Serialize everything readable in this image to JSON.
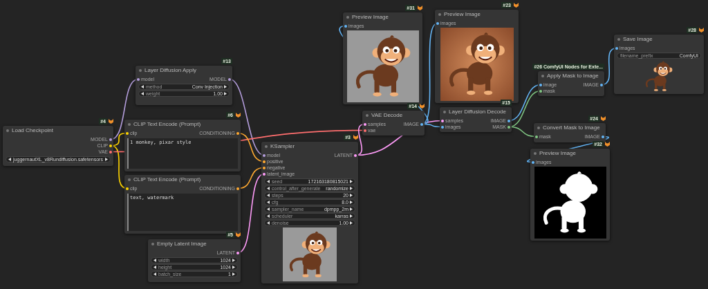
{
  "nodes": [
    {
      "badge": "#4",
      "badge_icon": true,
      "title": "Load Checkpoint",
      "outputs": [
        {
          "label": "MODEL",
          "color": "#b39ddb"
        },
        {
          "label": "CLIP",
          "color": "#ffd500"
        },
        {
          "label": "VAE",
          "color": "#ff6e6e"
        }
      ],
      "widgets": [
        {
          "kind": "combo",
          "value": "juggernautXL_v8Rundiffusion.safetensors"
        }
      ]
    },
    {
      "badge": "#13",
      "badge_icon": false,
      "title": "Layer Diffusion Apply",
      "inputs": [
        {
          "label": "model",
          "color": "#b39ddb"
        }
      ],
      "outputs": [
        {
          "label": "MODEL",
          "color": "#b39ddb"
        }
      ],
      "widgets": [
        {
          "kind": "combo",
          "label": "method",
          "value": "Conv Injection"
        },
        {
          "kind": "number",
          "label": "weight",
          "value": "1.00"
        }
      ]
    },
    {
      "badge": "#6",
      "badge_icon": true,
      "title": "CLIP Text Encode (Prompt)",
      "inputs": [
        {
          "label": "clip",
          "color": "#ffd500"
        }
      ],
      "outputs": [
        {
          "label": "CONDITIONING",
          "color": "#ffa931"
        }
      ],
      "text": "1 monkey, pixar style"
    },
    {
      "title": "CLIP Text Encode (Prompt)",
      "inputs": [
        {
          "label": "clip",
          "color": "#ffd500"
        }
      ],
      "outputs": [
        {
          "label": "CONDITIONING",
          "color": "#ffa931"
        }
      ],
      "text": "text, watermark"
    },
    {
      "badge": "#5",
      "badge_icon": true,
      "title": "Empty Latent Image",
      "outputs": [
        {
          "label": "LATENT",
          "color": "#ff9cf9"
        }
      ],
      "widgets": [
        {
          "kind": "number",
          "label": "width",
          "value": "1024"
        },
        {
          "kind": "number",
          "label": "height",
          "value": "1024"
        },
        {
          "kind": "number",
          "label": "batch_size",
          "value": "1"
        }
      ]
    },
    {
      "badge": "#3",
      "badge_icon": true,
      "title": "KSampler",
      "inputs": [
        {
          "label": "model",
          "color": "#b39ddb"
        },
        {
          "label": "positive",
          "color": "#ffa931"
        },
        {
          "label": "negative",
          "color": "#ffa931"
        },
        {
          "label": "latent_image",
          "color": "#ff9cf9"
        }
      ],
      "outputs": [
        {
          "label": "LATENT",
          "color": "#ff9cf9"
        }
      ],
      "widgets": [
        {
          "kind": "number",
          "label": "seed",
          "value": "172163180815021"
        },
        {
          "kind": "combo",
          "label": "control_after_generate",
          "value": "randomize"
        },
        {
          "kind": "number",
          "label": "steps",
          "value": "20"
        },
        {
          "kind": "number",
          "label": "cfg",
          "value": "8.0"
        },
        {
          "kind": "combo",
          "label": "sampler_name",
          "value": "dpmpp_2m"
        },
        {
          "kind": "combo",
          "label": "scheduler",
          "value": "karras"
        },
        {
          "kind": "number",
          "label": "denoise",
          "value": "1.00"
        }
      ],
      "preview": {
        "kind": "gray"
      }
    },
    {
      "badge": "#31",
      "badge_icon": true,
      "title": "Preview Image",
      "inputs": [
        {
          "label": "images",
          "color": "#64b5f6"
        }
      ],
      "preview": {
        "kind": "gray"
      }
    },
    {
      "badge": "#14",
      "badge_icon": true,
      "title": "VAE Decode",
      "inputs": [
        {
          "label": "samples",
          "color": "#ff9cf9"
        },
        {
          "label": "vae",
          "color": "#ff6e6e"
        }
      ],
      "outputs": [
        {
          "label": "IMAGE",
          "color": "#64b5f6"
        }
      ]
    },
    {
      "badge": "#23",
      "badge_icon": true,
      "title": "Preview Image",
      "inputs": [
        {
          "label": "images",
          "color": "#64b5f6"
        }
      ],
      "preview": {
        "kind": "warm"
      }
    },
    {
      "badge": "#15",
      "badge_icon": false,
      "title": "Layer Diffusion Decode",
      "inputs": [
        {
          "label": "samples",
          "color": "#ff9cf9"
        },
        {
          "label": "images",
          "color": "#64b5f6"
        }
      ],
      "outputs": [
        {
          "label": "IMAGE",
          "color": "#64b5f6"
        },
        {
          "label": "MASK",
          "color": "#81c784"
        }
      ]
    },
    {
      "badge": "#26 ComfyUI Nodes for Exte...",
      "badge_icon": false,
      "title": "Apply Mask to Image",
      "inputs": [
        {
          "label": "image",
          "color": "#64b5f6"
        },
        {
          "label": "mask",
          "color": "#81c784"
        }
      ],
      "outputs": [
        {
          "label": "IMAGE",
          "color": "#64b5f6"
        }
      ]
    },
    {
      "badge": "#28",
      "badge_icon": true,
      "title": "Save Image",
      "inputs": [
        {
          "label": "images",
          "color": "#64b5f6"
        }
      ],
      "widgets": [
        {
          "kind": "text",
          "label": "filename_prefix",
          "value": "ComfyUI"
        }
      ],
      "preview": {
        "kind": "cutout"
      }
    },
    {
      "badge": "#24",
      "badge_icon": true,
      "title": "Convert Mask to Image",
      "inputs": [
        {
          "label": "mask",
          "color": "#81c784"
        }
      ],
      "outputs": [
        {
          "label": "IMAGE",
          "color": "#64b5f6"
        }
      ]
    },
    {
      "badge": "#32",
      "badge_icon": true,
      "title": "Preview Image",
      "inputs": [
        {
          "label": "images",
          "color": "#64b5f6"
        }
      ],
      "preview": {
        "kind": "mask"
      }
    }
  ]
}
